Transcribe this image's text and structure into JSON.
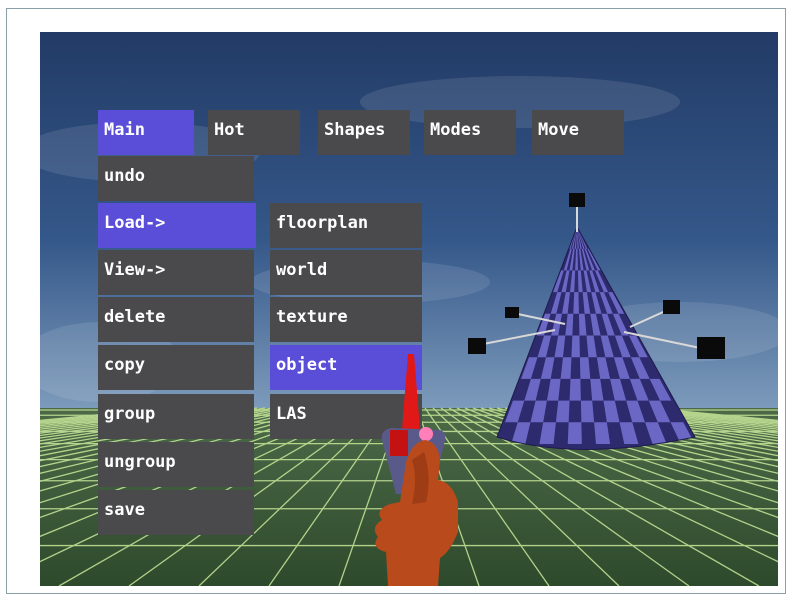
{
  "top_menu": [
    {
      "label": "Main",
      "selected": true
    },
    {
      "label": "Hot",
      "selected": false
    },
    {
      "label": "Shapes",
      "selected": false
    },
    {
      "label": "Modes",
      "selected": false
    },
    {
      "label": "Move",
      "selected": false
    }
  ],
  "main_menu": [
    {
      "label": "undo",
      "selected": false
    },
    {
      "label": "Load->",
      "selected": true
    },
    {
      "label": "View->",
      "selected": false
    },
    {
      "label": "delete",
      "selected": false
    },
    {
      "label": "copy",
      "selected": false
    },
    {
      "label": "group",
      "selected": false
    },
    {
      "label": "ungroup",
      "selected": false
    },
    {
      "label": "save",
      "selected": false
    }
  ],
  "load_submenu": [
    {
      "label": "floorplan",
      "selected": false
    },
    {
      "label": "world",
      "selected": false
    },
    {
      "label": "texture",
      "selected": false
    },
    {
      "label": "object",
      "selected": true
    },
    {
      "label": "LAS",
      "selected": false
    }
  ],
  "colors": {
    "menu_bg": "#4a4a4d",
    "menu_selected": "#5a4ed8",
    "menu_text": "#ffffff",
    "cone_dark": "#2e2a6e",
    "cone_light": "#6a68c4",
    "grid_line": "#c8e89a",
    "ground": "#3d5a3a",
    "sky_top": "#28436e",
    "sky_horizon": "#6e8fb0",
    "pointer_red": "#e01818",
    "hand": "#b84a1c"
  }
}
